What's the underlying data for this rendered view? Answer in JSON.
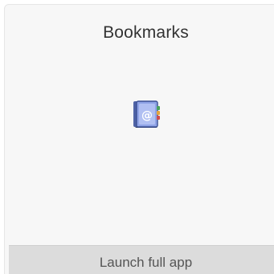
{
  "app": {
    "title": "Bookmarks",
    "icon": "address-book-icon"
  },
  "footer": {
    "launch_label": "Launch full app"
  }
}
